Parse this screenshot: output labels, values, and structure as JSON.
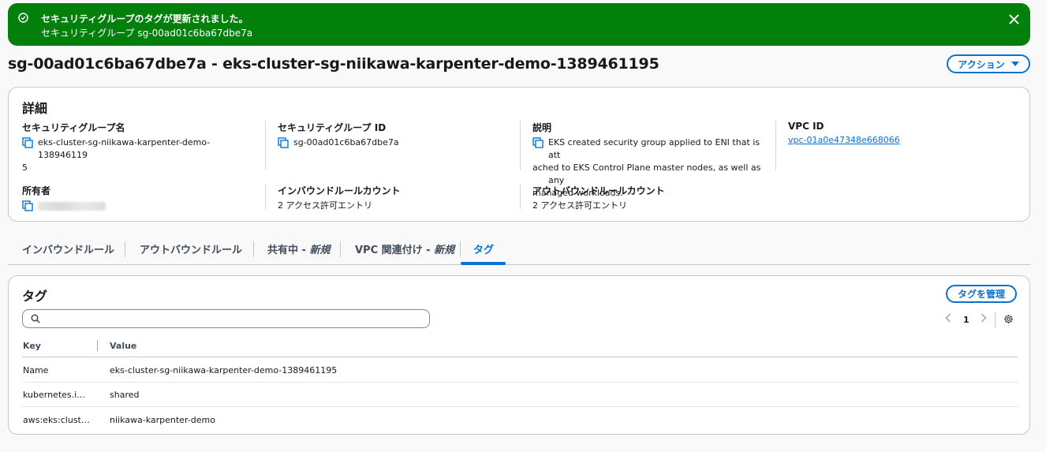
{
  "flash": {
    "title": "セキュリティグループのタグが更新されました。",
    "message": "セキュリティグループ sg-00ad01c6ba67dbe7a"
  },
  "page": {
    "title": "sg-00ad01c6ba67dbe7a - eks-cluster-sg-niikawa-karpenter-demo-1389461195",
    "action_label": "アクション"
  },
  "details": {
    "heading": "詳細",
    "sg_name_label": "セキュリティグループ名",
    "sg_name_line1": "eks-cluster-sg-niikawa-karpenter-demo-138946119",
    "sg_name_line2": "5",
    "sg_id_label": "セキュリティグループ ID",
    "sg_id_value": "sg-00ad01c6ba67dbe7a",
    "desc_label": "説明",
    "desc_line1": "EKS created security group applied to ENI that is att",
    "desc_line2": "ached to EKS Control Plane master nodes, as well as any",
    "desc_line3": "managed workloads.",
    "vpc_label": "VPC ID",
    "vpc_value": "vpc-01a0e47348e668066",
    "owner_label": "所有者",
    "inbound_label": "インバウンドルールカウント",
    "inbound_value": "2 アクセス許可エントリ",
    "outbound_label": "アウトバウンドルールカウント",
    "outbound_value": "2 アクセス許可エントリ"
  },
  "tabs": {
    "inbound": "インバウンドルール",
    "outbound": "アウトバウンドルール",
    "sharing": "共有中 - ",
    "sharing_new": "新規",
    "vpc_assoc": "VPC 関連付け - ",
    "vpc_assoc_new": "新規",
    "tags": "タグ"
  },
  "tags_panel": {
    "heading": "タグ",
    "manage_label": "タグを管理",
    "search_placeholder": "",
    "page_number": "1",
    "columns": {
      "key": "Key",
      "value": "Value"
    },
    "rows": [
      {
        "key": "Name",
        "value": "eks-cluster-sg-niikawa-karpenter-demo-1389461195"
      },
      {
        "key": "kubernetes.i…",
        "value": "shared"
      },
      {
        "key": "aws:eks:clust…",
        "value": "niikawa-karpenter-demo"
      }
    ]
  },
  "colors": {
    "success": "#037f0c",
    "primary": "#0972d3"
  }
}
